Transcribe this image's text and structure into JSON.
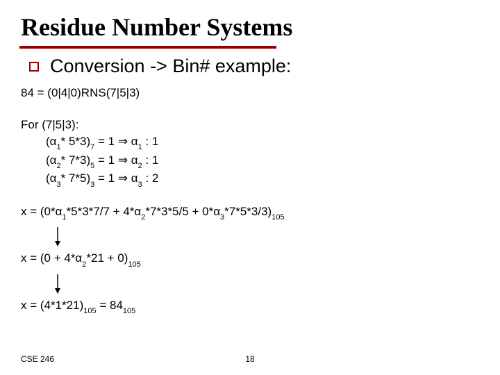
{
  "title": "Residue Number Systems",
  "bullet": "Conversion -> Bin# example:",
  "line_84": "84 = (0|4|0)RNS(7|5|3)",
  "for_header": "For (7|5|3):",
  "for_rows": [
    {
      "left": "(α",
      "sub": "1",
      "mid": "* 5*3)",
      "modsub": "7",
      "right": " = 1 ⇒ α",
      "rsub": "1",
      "tail": " : 1"
    },
    {
      "left": "(α",
      "sub": "2",
      "mid": "* 7*3)",
      "modsub": "5",
      "right": " = 1 ⇒ α",
      "rsub": "2",
      "tail": " : 1"
    },
    {
      "left": "(α",
      "sub": "3",
      "mid": "* 7*5)",
      "modsub": "3",
      "right": " = 1 ⇒ α",
      "rsub": "3",
      "tail": " : 2"
    }
  ],
  "x_line1": {
    "pre": "x = (0*α",
    "s1": "1",
    "m1": "*5*3*7/7 + 4*α",
    "s2": "2",
    "m2": "*7*3*5/5 + 0*α",
    "s3": "3",
    "m3": "*7*5*3/3)",
    "basesub": "105"
  },
  "x_line2": {
    "pre": "x = (0 + 4*α",
    "s1": "2",
    "m1": "*21 + 0)",
    "basesub": "105"
  },
  "x_line3": {
    "pre": "x = (4*1*21)",
    "sub1": "105",
    "mid": " = 84",
    "sub2": "105"
  },
  "footer": {
    "course": "CSE 246",
    "page": "18"
  }
}
